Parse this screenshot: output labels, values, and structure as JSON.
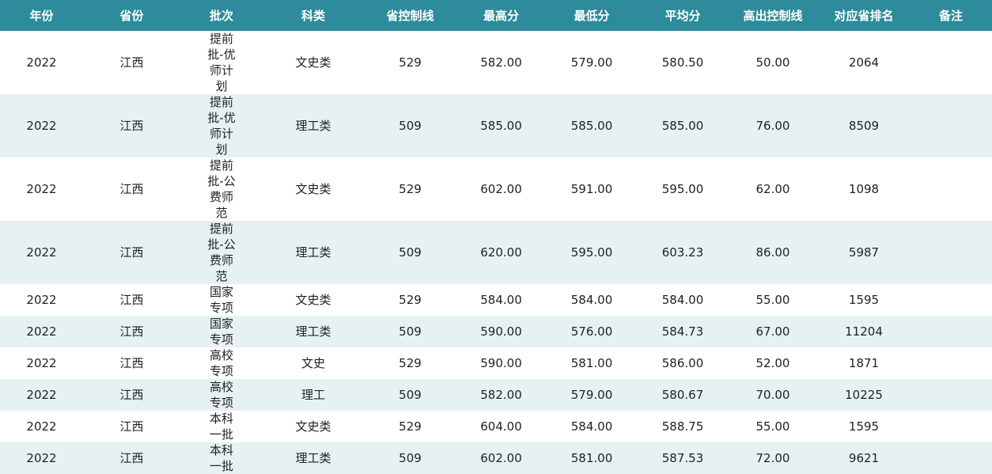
{
  "headers": [
    "年份",
    "省份",
    "批次",
    "科类",
    "省控制线",
    "最高分",
    "最低分",
    "平均分",
    "高出控制线",
    "对应省排名",
    "备注"
  ],
  "rows": [
    [
      "2022",
      "江西",
      "提前批-优师计划",
      "文史类",
      "529",
      "582.00",
      "579.00",
      "580.50",
      "50.00",
      "2064",
      ""
    ],
    [
      "2022",
      "江西",
      "提前批-优师计划",
      "理工类",
      "509",
      "585.00",
      "585.00",
      "585.00",
      "76.00",
      "8509",
      ""
    ],
    [
      "2022",
      "江西",
      "提前批-公费师范",
      "文史类",
      "529",
      "602.00",
      "591.00",
      "595.00",
      "62.00",
      "1098",
      ""
    ],
    [
      "2022",
      "江西",
      "提前批-公费师范",
      "理工类",
      "509",
      "620.00",
      "595.00",
      "603.23",
      "86.00",
      "5987",
      ""
    ],
    [
      "2022",
      "江西",
      "国家专项",
      "文史类",
      "529",
      "584.00",
      "584.00",
      "584.00",
      "55.00",
      "1595",
      ""
    ],
    [
      "2022",
      "江西",
      "国家专项",
      "理工类",
      "509",
      "590.00",
      "576.00",
      "584.73",
      "67.00",
      "11204",
      ""
    ],
    [
      "2022",
      "江西",
      "高校专项",
      "文史",
      "529",
      "590.00",
      "581.00",
      "586.00",
      "52.00",
      "1871",
      ""
    ],
    [
      "2022",
      "江西",
      "高校专项",
      "理工",
      "509",
      "582.00",
      "579.00",
      "580.67",
      "70.00",
      "10225",
      ""
    ],
    [
      "2022",
      "江西",
      "本科一批",
      "文史类",
      "529",
      "604.00",
      "584.00",
      "588.75",
      "55.00",
      "1595",
      ""
    ],
    [
      "2022",
      "江西",
      "本科一批",
      "理工类",
      "509",
      "602.00",
      "581.00",
      "587.53",
      "72.00",
      "9621",
      ""
    ]
  ],
  "colors": {
    "header_bg": "#2e8b9b",
    "alt_row_bg": "#e6f1f3"
  }
}
